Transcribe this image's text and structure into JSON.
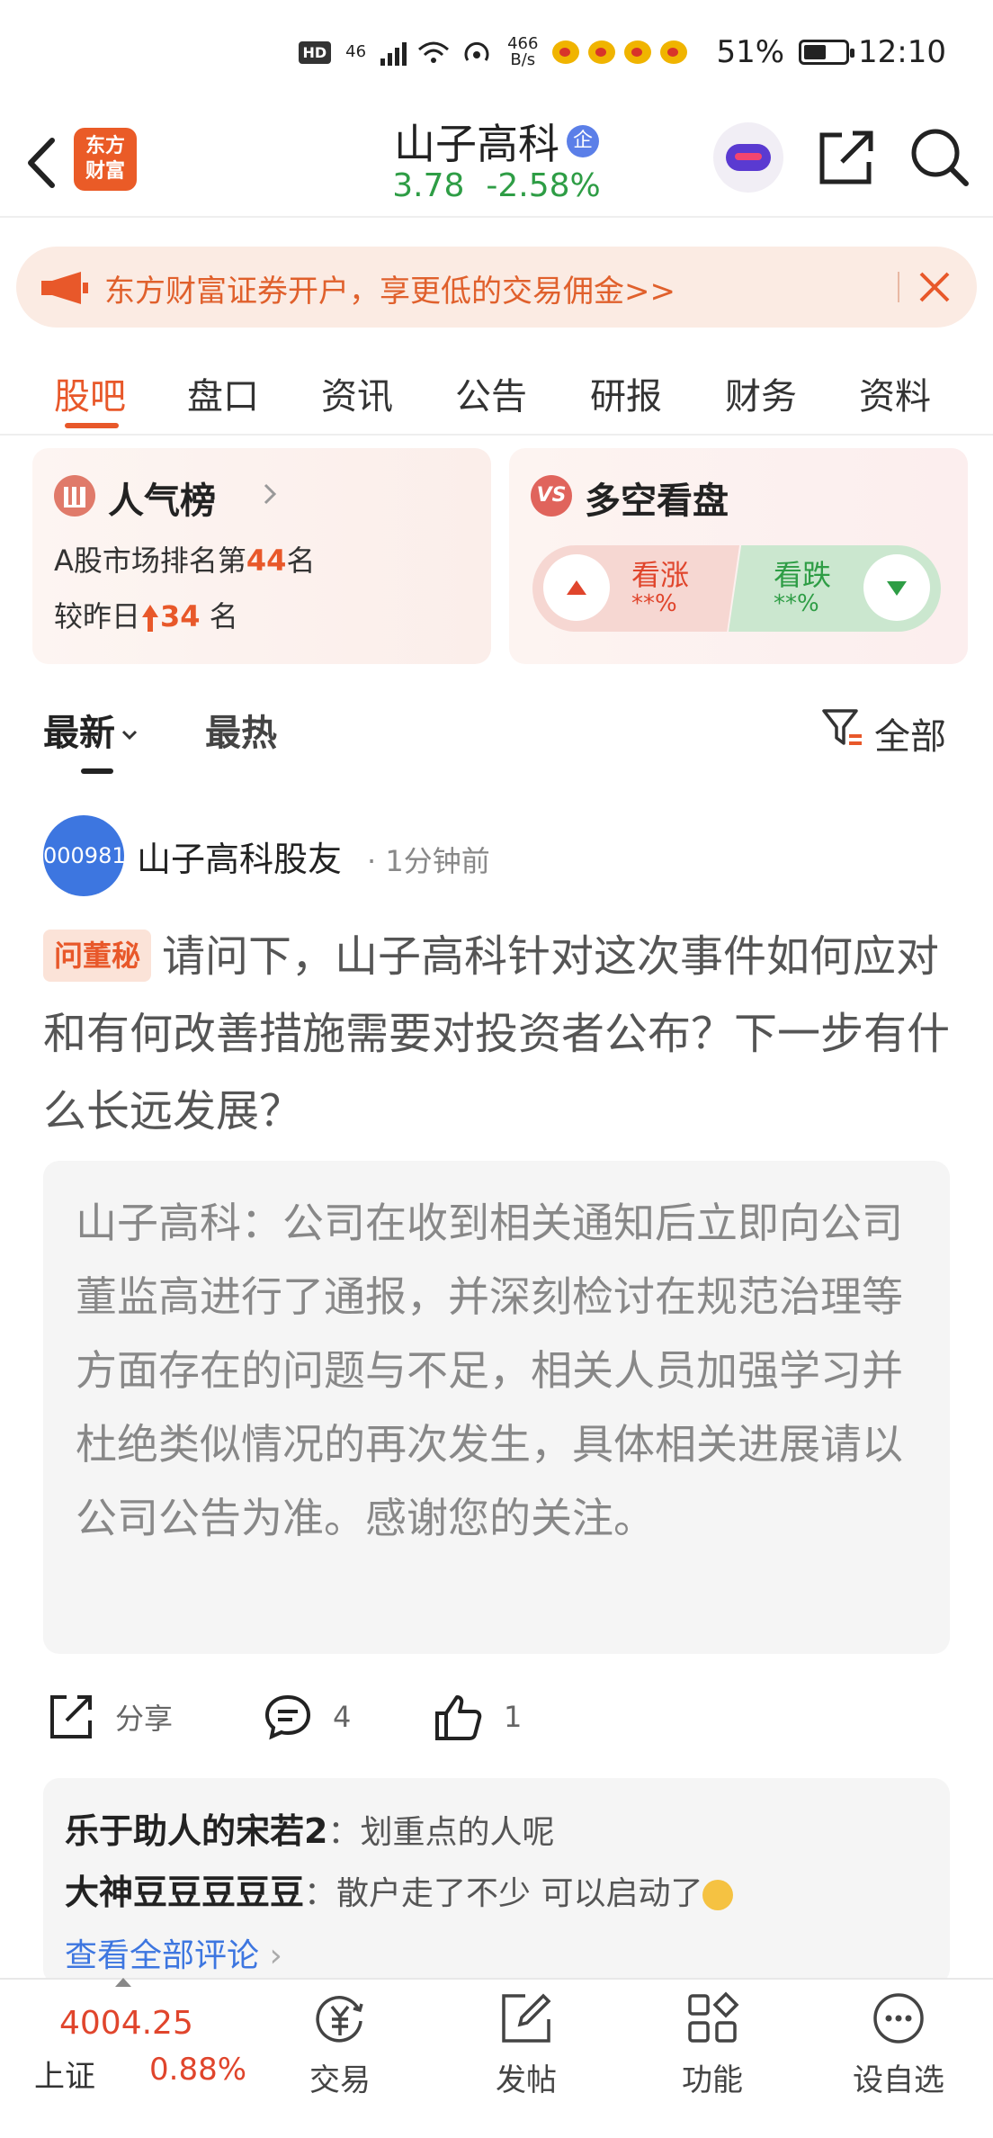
{
  "status_bar": {
    "hd": "HD",
    "net_top": "46",
    "net_speed_value": "466",
    "net_speed_unit": "B/s",
    "battery": "51%",
    "time": "12:10"
  },
  "header": {
    "logo_line1": "东方",
    "logo_line2": "财富",
    "stock_name": "山子高科",
    "verify_badge": "企",
    "price": "3.78",
    "change_pct": "-2.58%"
  },
  "banner": {
    "text": "东方财富证券开户，享更低的交易佣金>>"
  },
  "tabs": [
    {
      "label": "股吧",
      "active": true
    },
    {
      "label": "盘口",
      "active": false
    },
    {
      "label": "资讯",
      "active": false
    },
    {
      "label": "公告",
      "active": false
    },
    {
      "label": "研报",
      "active": false
    },
    {
      "label": "财务",
      "active": false
    },
    {
      "label": "资料",
      "active": false
    }
  ],
  "popularity": {
    "title": "人气榜",
    "rank_prefix": "A股市场排名第",
    "rank": "44",
    "rank_suffix": "名",
    "change_prefix": "较昨日",
    "change": "34",
    "change_suffix": "名"
  },
  "sentiment": {
    "title": "多空看盘",
    "vs": "VS",
    "bull_label": "看涨",
    "bull_pct": "**%",
    "bear_label": "看跌",
    "bear_pct": "**%"
  },
  "sort": {
    "latest": "最新",
    "hot": "最热",
    "filter": "全部"
  },
  "post": {
    "avatar_text": "000981",
    "author": "山子高科股友",
    "time": "· 1分钟前",
    "badge": "问董秘",
    "question": "请问下，山子高科针对这次事件如何应对和有何改善措施需要对投资者公布？下一步有什么长远发展？",
    "answer": "山子高科：公司在收到相关通知后立即向公司董监高进行了通报，并深刻检讨在规范治理等方面存在的问题与不足，相关人员加强学习并杜绝类似情况的再次发生，具体相关进展请以公司公告为准。感谢您的关注。",
    "share_label": "分享",
    "comment_count": "4",
    "like_count": "1"
  },
  "comments": [
    {
      "user": "乐于助人的宋若2",
      "text": "：划重点的人呢"
    },
    {
      "user": "大神豆豆豆豆豆",
      "text": "：散户走了不少  可以启动了"
    }
  ],
  "view_all": "查看全部评论",
  "bottom_bar": {
    "index_value": "4004.25",
    "index_name": "上证",
    "index_pct": "0.88%",
    "items": [
      {
        "label": "交易",
        "icon": "trade-icon"
      },
      {
        "label": "发帖",
        "icon": "compose-icon"
      },
      {
        "label": "功能",
        "icon": "grid-icon"
      },
      {
        "label": "设自选",
        "icon": "more-icon"
      }
    ]
  },
  "colors": {
    "accent": "#e8582a",
    "down_green": "#2e9d45",
    "up_red": "#e0452c",
    "link_blue": "#3d76e0"
  }
}
